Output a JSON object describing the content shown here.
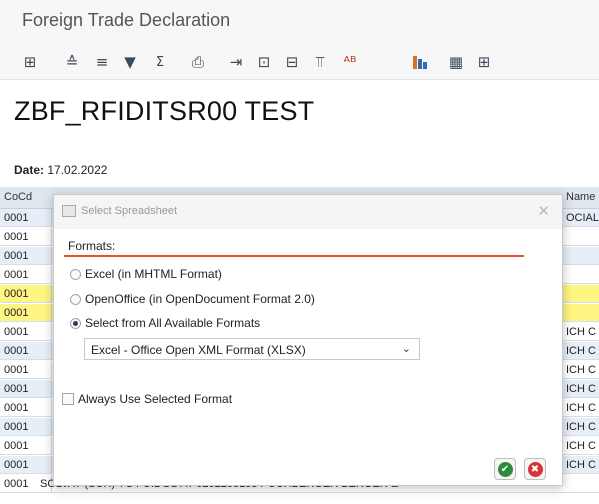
{
  "window": {
    "title": "Foreign Trade Declaration"
  },
  "toolbar": {
    "icons": [
      "details-icon",
      "sort-ascending-icon",
      "sort-descending-icon",
      "filter-icon",
      "sum-icon",
      "print-icon",
      "export-icon",
      "local-file-icon",
      "spreadsheet-icon",
      "layout-icon",
      "abc-icon",
      "chart-icon",
      "grid-icon",
      "variant-icon"
    ]
  },
  "report": {
    "title": "ZBF_RFIDITSR00 TEST",
    "date_label": "Date:",
    "date_value": "17.02.2022"
  },
  "table": {
    "headers": [
      "CoCd",
      "Name"
    ],
    "rows": [
      {
        "cocd": "0001",
        "right": "OCIAL",
        "style": "blue"
      },
      {
        "cocd": "0001",
        "right": "",
        "style": "light"
      },
      {
        "cocd": "0001",
        "right": "",
        "style": "blue"
      },
      {
        "cocd": "0001",
        "right": "",
        "style": "light"
      },
      {
        "cocd": "0001",
        "right": "",
        "style": "yellow"
      },
      {
        "cocd": "0001",
        "right": "",
        "style": "yellow"
      },
      {
        "cocd": "0001",
        "right": "ICH C",
        "style": "light"
      },
      {
        "cocd": "0001",
        "right": "ICH C",
        "style": "blue"
      },
      {
        "cocd": "0001",
        "right": "ICH C",
        "style": "light"
      },
      {
        "cocd": "0001",
        "right": "ICH C",
        "style": "blue"
      },
      {
        "cocd": "0001",
        "right": "ICH C",
        "style": "light"
      },
      {
        "cocd": "0001",
        "right": "ICH C",
        "style": "blue"
      },
      {
        "cocd": "0001",
        "right": "ICH C",
        "style": "light"
      },
      {
        "cocd": "0001",
        "right": "ICH C",
        "style": "blue"
      },
      {
        "cocd": "0001",
        "right": "SOLVAY (SCH) YC   FUIDGS  AT          0202205153  PUCHBERGER BERGER &",
        "style": "light"
      }
    ]
  },
  "dialog": {
    "title": "Select Spreadsheet",
    "formats_label": "Formats:",
    "options": [
      {
        "label": "Excel (in MHTML Format)",
        "checked": false
      },
      {
        "label": "OpenOffice (in OpenDocument Format 2.0)",
        "checked": false
      },
      {
        "label": "Select from All Available Formats",
        "checked": true
      }
    ],
    "format_select_value": "Excel - Office Open XML Format (XLSX)",
    "always_use_label": "Always Use Selected Format",
    "always_use_checked": false
  },
  "colors": {
    "accent_line": "#e0552b",
    "ok_green": "#2f8a3c",
    "cancel_red": "#d6333b",
    "highlight_yellow": "#fff582"
  }
}
